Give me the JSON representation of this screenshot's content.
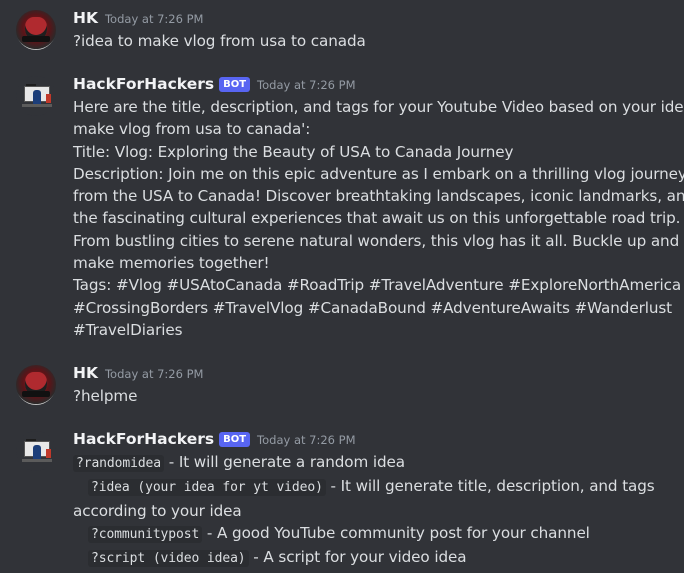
{
  "messages": [
    {
      "user": "HK",
      "timestamp": "Today at 7:26 PM",
      "lines": [
        "?idea to make vlog from usa to canada"
      ]
    },
    {
      "user": "HackForHackers",
      "badge": "BOT",
      "timestamp": "Today at 7:26 PM",
      "lines": [
        "Here are the title, description, and tags for your Youtube Video based on your idea 'to",
        "make vlog from usa to canada':",
        "Title: Vlog: Exploring the Beauty of USA to Canada Journey",
        "Description: Join me on this epic adventure as I embark on a thrilling vlog journey",
        "from the USA to Canada! Discover breathtaking landscapes, iconic landmarks, and",
        "the fascinating cultural experiences that await us on this unforgettable road trip.",
        "From bustling cities to serene natural wonders, this vlog has it all. Buckle up and let's",
        "make memories together!",
        "Tags: #Vlog #USAtoCanada #RoadTrip #TravelAdventure #ExploreNorthAmerica",
        "#CrossingBorders #TravelVlog #CanadaBound #AdventureAwaits #Wanderlust",
        "#TravelDiaries"
      ]
    },
    {
      "user": "HK",
      "timestamp": "Today at 7:26 PM",
      "lines": [
        "?helpme"
      ]
    },
    {
      "user": "HackForHackers",
      "badge": "BOT",
      "timestamp": "Today at 7:26 PM",
      "help": [
        {
          "cmd": "?randomidea",
          "desc": " - It will generate a random idea"
        },
        {
          "cmd": "?idea (your idea for yt video)",
          "desc": " - It will generate title, description, and tags"
        },
        {
          "continuation": "according to your idea"
        },
        {
          "cmd": "?communitypost",
          "desc": " - A good YouTube community post for your channel"
        },
        {
          "cmd": "?script (video idea)",
          "desc": " - A script for your video idea"
        }
      ]
    }
  ]
}
